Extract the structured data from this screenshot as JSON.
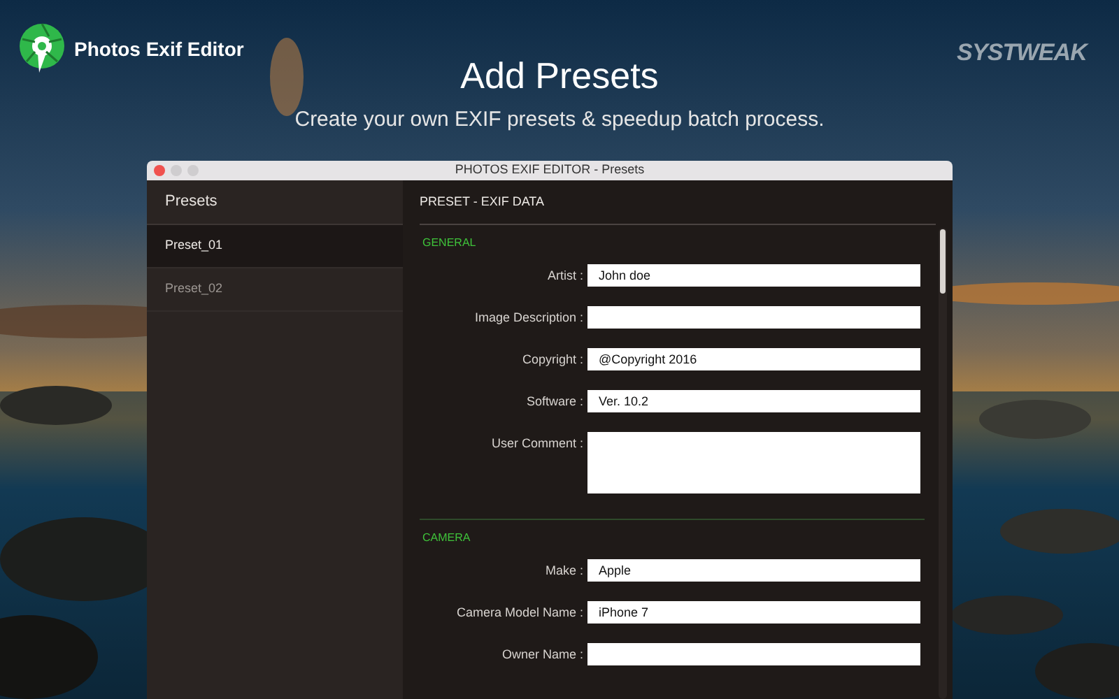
{
  "app": {
    "name": "Photos Exif Editor",
    "brand": "SYSTWEAK"
  },
  "hero": {
    "title": "Add Presets",
    "subtitle": "Create your own EXIF presets & speedup batch process."
  },
  "window": {
    "title": "PHOTOS EXIF EDITOR - Presets"
  },
  "sidebar": {
    "title": "Presets",
    "items": [
      {
        "label": "Preset_01",
        "selected": true
      },
      {
        "label": "Preset_02",
        "selected": false
      }
    ]
  },
  "panel": {
    "title": "PRESET - EXIF DATA",
    "sections": [
      {
        "title": "GENERAL",
        "fields": [
          {
            "label": "Artist :",
            "kind": "line",
            "value": "John doe"
          },
          {
            "label": "Image Description :",
            "kind": "line"
          },
          {
            "label": "Copyright :",
            "kind": "line",
            "value": "@Copyright 2016"
          },
          {
            "label": "Software :",
            "kind": "line",
            "value": "Ver. 10.2"
          },
          {
            "label": "User Comment :",
            "kind": "area"
          }
        ]
      },
      {
        "title": "CAMERA",
        "fields": [
          {
            "label": "Make :",
            "kind": "line",
            "value": "Apple"
          },
          {
            "label": "Camera Model Name :",
            "kind": "line",
            "value": "iPhone 7"
          },
          {
            "label": "Owner Name :",
            "kind": "line"
          }
        ]
      }
    ]
  }
}
